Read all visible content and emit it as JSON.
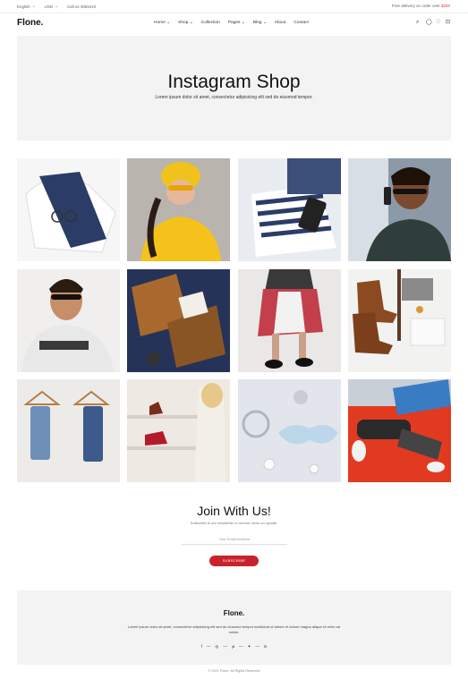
{
  "topbar": {
    "language": "English",
    "currency": "USD",
    "phone": "Call us 3965410",
    "promo_text": "Free delivery on order over ",
    "promo_amount": "$200"
  },
  "header": {
    "logo": "Flone.",
    "nav": [
      "Home",
      "Shop",
      "Collection",
      "Pages",
      "Blog",
      "About",
      "Contact"
    ],
    "nav_dropdowns": [
      "Home",
      "Shop",
      "Pages",
      "Blog"
    ]
  },
  "hero": {
    "title": "Instagram Shop",
    "subtitle": "Lorem ipsum dolor sit amet, consectetur adipisicing elit sed do eiusmod tempor."
  },
  "gallery": {
    "count": 12
  },
  "newsletter": {
    "title": "Join With Us!",
    "subtitle": "Subscribe to our newsletter to receive news on update.",
    "email_placeholder": "Your Email Address",
    "button": "SUBSCRIBE"
  },
  "footer": {
    "logo": "Flone.",
    "text": "Lorem ipsum dolor sit amet, consectetur adipisicing elit sed do eiusmod tempor incididunt ut labore et dolore magna aliqua Ut enim ad minim.",
    "social_icons": [
      "facebook-icon",
      "instagram-icon",
      "pinterest-icon",
      "twitter-icon",
      "linkedin-icon"
    ],
    "copyright": "© 2021 Flone. All Rights Reserved"
  },
  "colors": {
    "accent": "#c8232c",
    "promo": "#e8363a",
    "hero_bg": "#f3f3f3"
  }
}
